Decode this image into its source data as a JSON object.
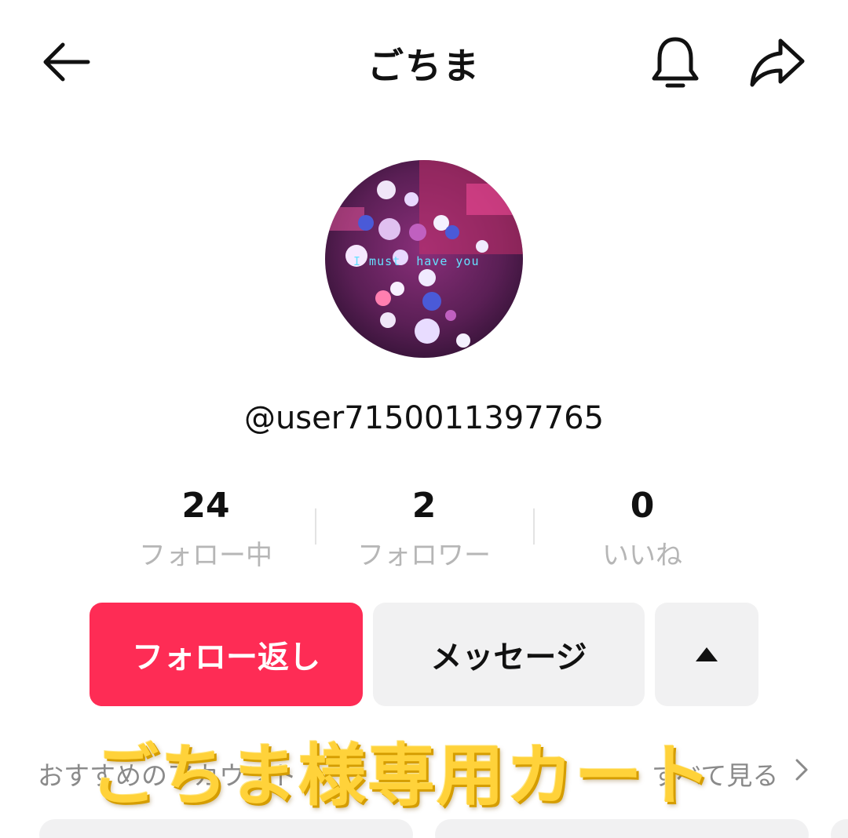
{
  "header": {
    "title": "ごちま",
    "back_icon": "back-arrow-icon",
    "bell_icon": "bell-icon",
    "share_icon": "share-icon"
  },
  "profile": {
    "avatar_caption": "I must  have you",
    "username": "@user7150011397765"
  },
  "stats": [
    {
      "value": "24",
      "label": "フォロー中"
    },
    {
      "value": "2",
      "label": "フォロワー"
    },
    {
      "value": "0",
      "label": "いいね"
    }
  ],
  "actions": {
    "follow_back": "フォロー返し",
    "message": "メッセージ",
    "more_icon": "triangle-up-icon"
  },
  "suggested": {
    "heading": "おすすめのアカウント",
    "see_all": "すべて見る"
  },
  "overlay": {
    "banner": "ごちま様専用カート"
  },
  "colors": {
    "accent": "#fe2c55",
    "secondary_button": "#f1f1f2",
    "banner": "#ffd23a"
  }
}
